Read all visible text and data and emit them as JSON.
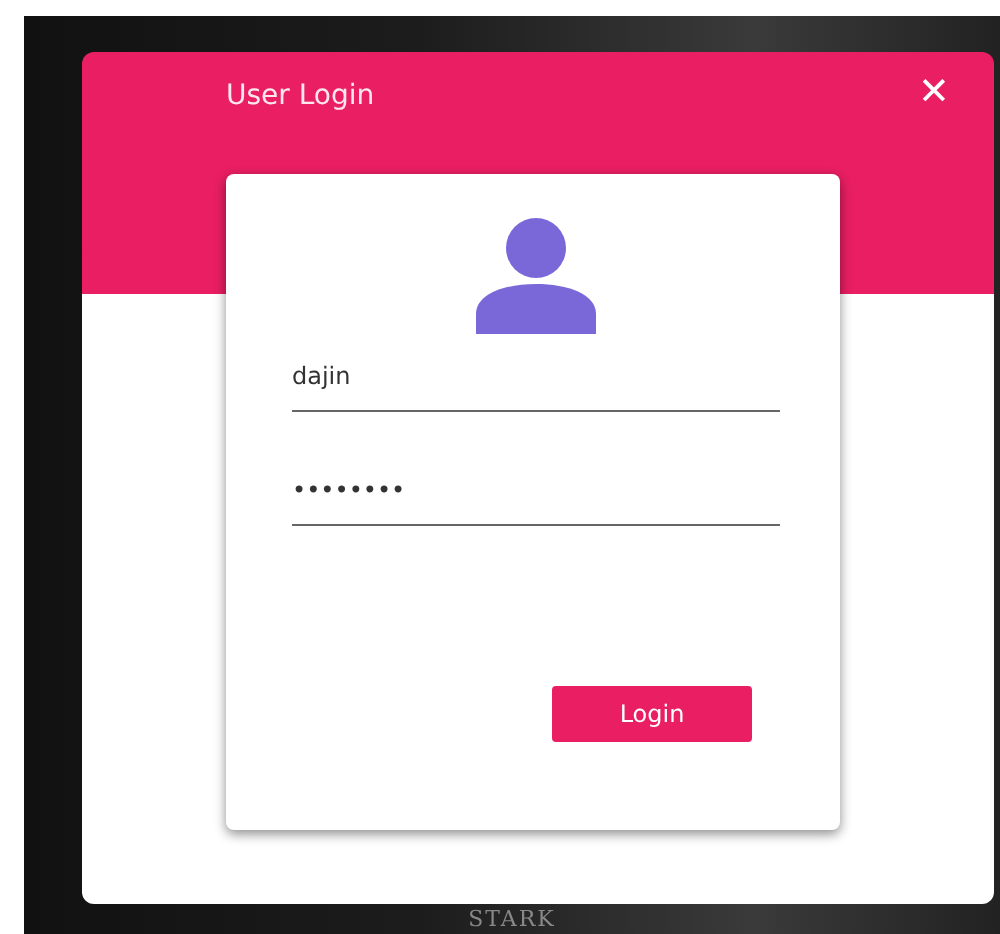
{
  "dialog": {
    "title": "User Login",
    "close": "✕"
  },
  "form": {
    "username": "dajin",
    "password": "••••••••",
    "submit": "Login"
  },
  "background": {
    "text": "STARK"
  }
}
